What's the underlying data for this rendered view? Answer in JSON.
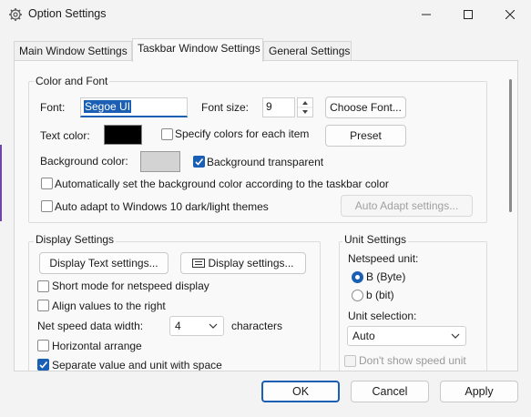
{
  "window": {
    "title": "Option Settings",
    "app_icon": "gear-icon"
  },
  "caption_buttons": {
    "minimize": "minimize-icon",
    "maximize": "maximize-icon",
    "close": "close-icon"
  },
  "tabs": [
    {
      "label": "Main Window Settings",
      "active": false
    },
    {
      "label": "Taskbar Window Settings",
      "active": true
    },
    {
      "label": "General Settings",
      "active": false
    }
  ],
  "color_font": {
    "title": "Color and Font",
    "font_label": "Font:",
    "font_value": "Segoe UI",
    "font_size_label": "Font size:",
    "font_size_value": "9",
    "choose_font_label": "Choose Font...",
    "text_color_label": "Text color:",
    "text_color_value": "#000000",
    "specify_colors_label": "Specify colors for each item",
    "specify_colors_checked": false,
    "preset_label": "Preset",
    "bg_color_label": "Background color:",
    "bg_color_value": "#d3d3d3",
    "bg_transparent_label": "Background transparent",
    "bg_transparent_checked": true,
    "auto_bg_label": "Automatically set the background color according to the taskbar color",
    "auto_bg_checked": false,
    "auto_adapt_label": "Auto adapt to Windows 10 dark/light themes",
    "auto_adapt_checked": false,
    "auto_adapt_settings_label": "Auto Adapt settings..."
  },
  "display": {
    "title": "Display Settings",
    "display_text_btn": "Display Text settings...",
    "display_settings_btn": "Display settings...",
    "short_mode_label": "Short mode for netspeed display",
    "short_mode_checked": false,
    "align_right_label": "Align values to the right",
    "align_right_checked": false,
    "speed_width_label": "Net speed data width:",
    "speed_width_value": "4",
    "characters_label": "characters",
    "horizontal_label": "Horizontal arrange",
    "horizontal_checked": false,
    "separate_label": "Separate value and unit with space",
    "separate_checked": true
  },
  "unit": {
    "title": "Unit Settings",
    "netspeed_unit_label": "Netspeed unit:",
    "byte_label": "B (Byte)",
    "bit_label": "b (bit)",
    "selected": "byte",
    "unit_selection_label": "Unit selection:",
    "unit_selection_value": "Auto",
    "dont_show_label": "Don't show speed unit",
    "dont_show_checked": false
  },
  "footer": {
    "ok": "OK",
    "cancel": "Cancel",
    "apply": "Apply"
  },
  "colors": {
    "accent": "#1a5fb4",
    "edge": "#6e46a8"
  }
}
